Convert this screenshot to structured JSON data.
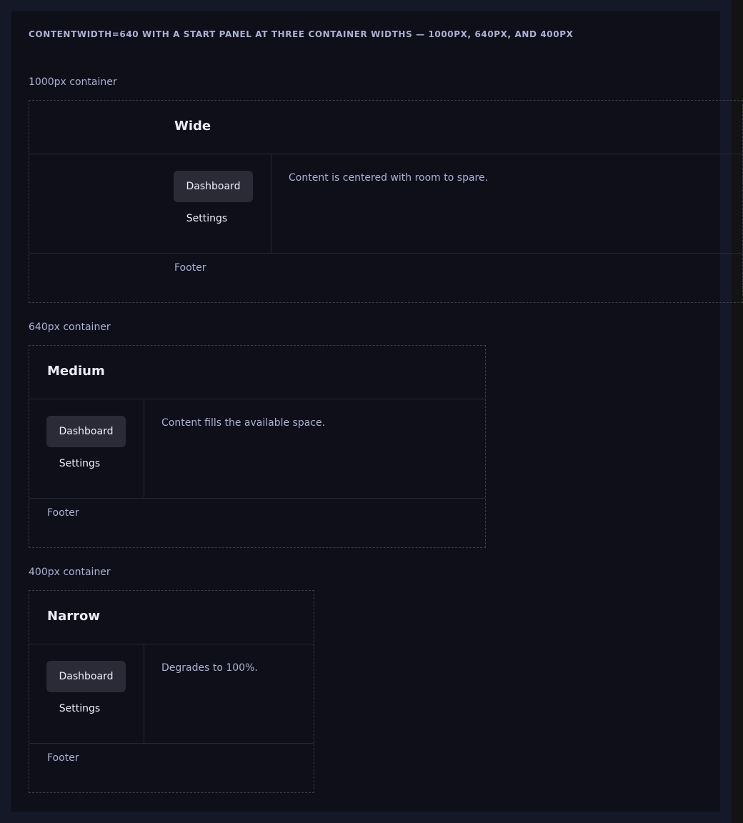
{
  "heading": "CONTENTWIDTH=640 WITH A START PANEL AT THREE CONTAINER WIDTHS — 1000PX, 640PX, AND 400PX",
  "demos": [
    {
      "label": "1000px container",
      "title": "Wide",
      "nav": [
        "Dashboard",
        "Settings"
      ],
      "content": "Content is centered with room to spare.",
      "footer": "Footer"
    },
    {
      "label": "640px container",
      "title": "Medium",
      "nav": [
        "Dashboard",
        "Settings"
      ],
      "content": "Content fills the available space.",
      "footer": "Footer"
    },
    {
      "label": "400px container",
      "title": "Narrow",
      "nav": [
        "Dashboard",
        "Settings"
      ],
      "content": "Degrades to 100%.",
      "footer": "Footer"
    }
  ]
}
